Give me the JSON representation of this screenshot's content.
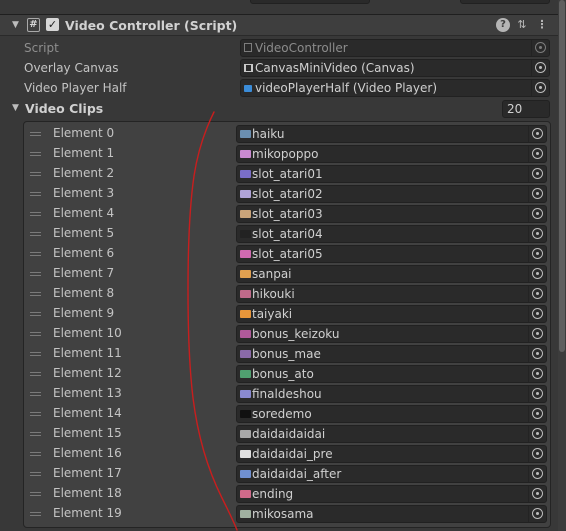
{
  "component": {
    "title": "Video Controller (Script)",
    "enabled_mark": "✓",
    "script_icon": "#",
    "icons": {
      "help": "?",
      "presets": "⇅",
      "menu": "⋮"
    }
  },
  "properties": {
    "script": {
      "label": "Script",
      "value": "VideoController"
    },
    "overlay_canvas": {
      "label": "Overlay Canvas",
      "value": "CanvasMiniVideo (Canvas)"
    },
    "video_player_half": {
      "label": "Video Player Half",
      "value": "videoPlayerHalf (Video Player)"
    }
  },
  "video_clips": {
    "label": "Video Clips",
    "size": "20",
    "elements": [
      {
        "label": "Element 0",
        "value": "haiku",
        "thumb": "#6b8fb0"
      },
      {
        "label": "Element 1",
        "value": "mikopoppo",
        "thumb": "#c98ad0"
      },
      {
        "label": "Element 2",
        "value": "slot_atari01",
        "thumb": "#7a6ec7"
      },
      {
        "label": "Element 3",
        "value": "slot_atari02",
        "thumb": "#b0a4d8"
      },
      {
        "label": "Element 4",
        "value": "slot_atari03",
        "thumb": "#c9a47a"
      },
      {
        "label": "Element 5",
        "value": "slot_atari04",
        "thumb": "#222222"
      },
      {
        "label": "Element 6",
        "value": "slot_atari05",
        "thumb": "#d06ab0"
      },
      {
        "label": "Element 7",
        "value": "sanpai",
        "thumb": "#e0a050"
      },
      {
        "label": "Element 8",
        "value": "hikouki",
        "thumb": "#c06a8a"
      },
      {
        "label": "Element 9",
        "value": "taiyaki",
        "thumb": "#e8963a"
      },
      {
        "label": "Element 10",
        "value": "bonus_keizoku",
        "thumb": "#b05a9a"
      },
      {
        "label": "Element 11",
        "value": "bonus_mae",
        "thumb": "#8a6aa8"
      },
      {
        "label": "Element 12",
        "value": "bonus_ato",
        "thumb": "#50a070"
      },
      {
        "label": "Element 13",
        "value": "finaldeshou",
        "thumb": "#8a8ad0"
      },
      {
        "label": "Element 14",
        "value": "soredemo",
        "thumb": "#111111"
      },
      {
        "label": "Element 15",
        "value": "daidaidaidai",
        "thumb": "#a8a8a8"
      },
      {
        "label": "Element 16",
        "value": "daidaidai_pre",
        "thumb": "#e0e0e0"
      },
      {
        "label": "Element 17",
        "value": "daidaidai_after",
        "thumb": "#7090d0"
      },
      {
        "label": "Element 18",
        "value": "ending",
        "thumb": "#d06a8a"
      },
      {
        "label": "Element 19",
        "value": "mikosama",
        "thumb": "#a0b0a0"
      }
    ]
  },
  "colors": {
    "annotation_stroke": "#c81e1e"
  }
}
